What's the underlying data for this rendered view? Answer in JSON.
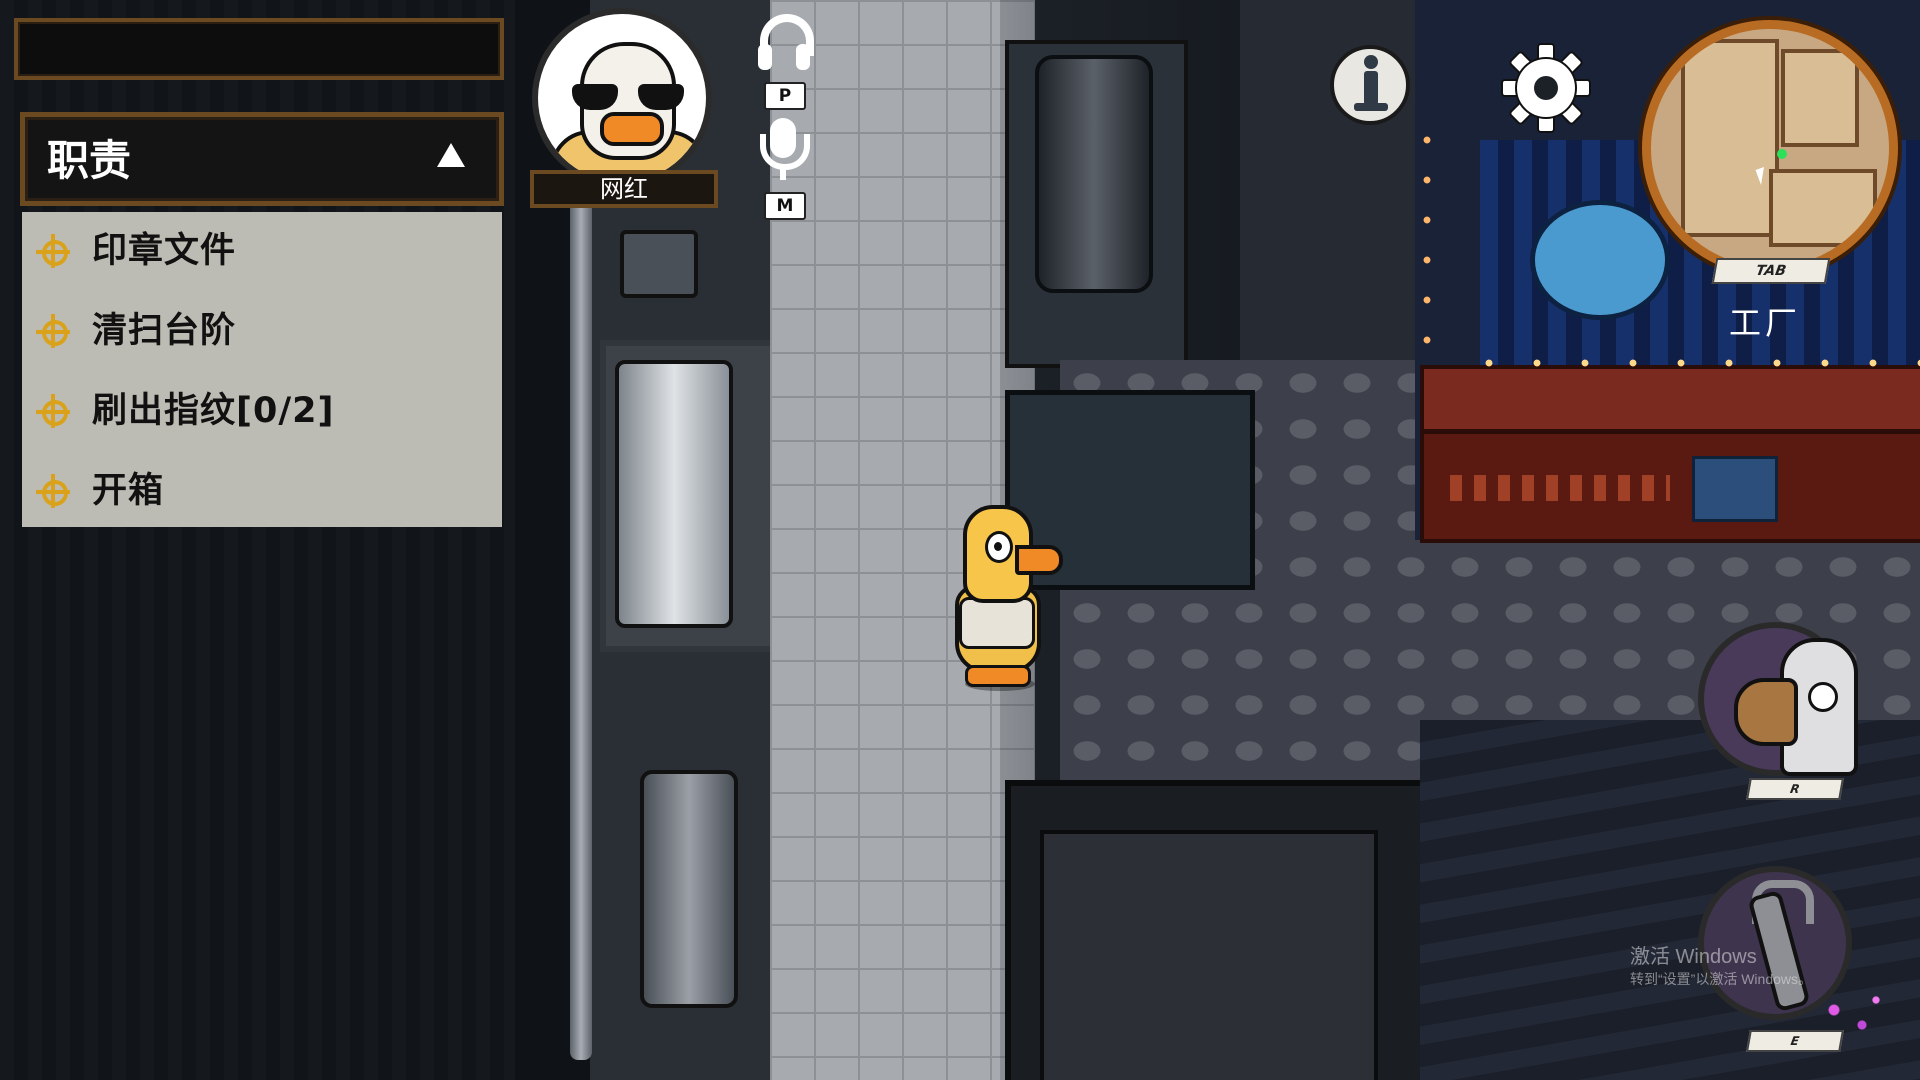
{
  "hud": {
    "name_bar": "",
    "tasks": {
      "title": "职责",
      "items": [
        {
          "label": "印章文件"
        },
        {
          "label": "清扫台阶"
        },
        {
          "label": "刷出指纹[0/2]"
        },
        {
          "label": "开箱"
        }
      ]
    },
    "player": {
      "role": "网红"
    },
    "audio": {
      "speaker_key": "P",
      "mic_key": "M"
    },
    "minimap": {
      "key": "TAB",
      "location": "工厂"
    },
    "abilities": [
      {
        "key": "R",
        "icon": "horn-goose-icon"
      },
      {
        "key": "E",
        "icon": "wrench-icon"
      }
    ]
  },
  "watermark": {
    "title": "激活 Windows",
    "subtitle": "转到“设置”以激活 Windows。"
  },
  "colors": {
    "panel_border": "#6b4a22",
    "task_icon": "#d9a21a",
    "minimap_ring": "#b86b22",
    "player_dot": "#2de05a"
  }
}
